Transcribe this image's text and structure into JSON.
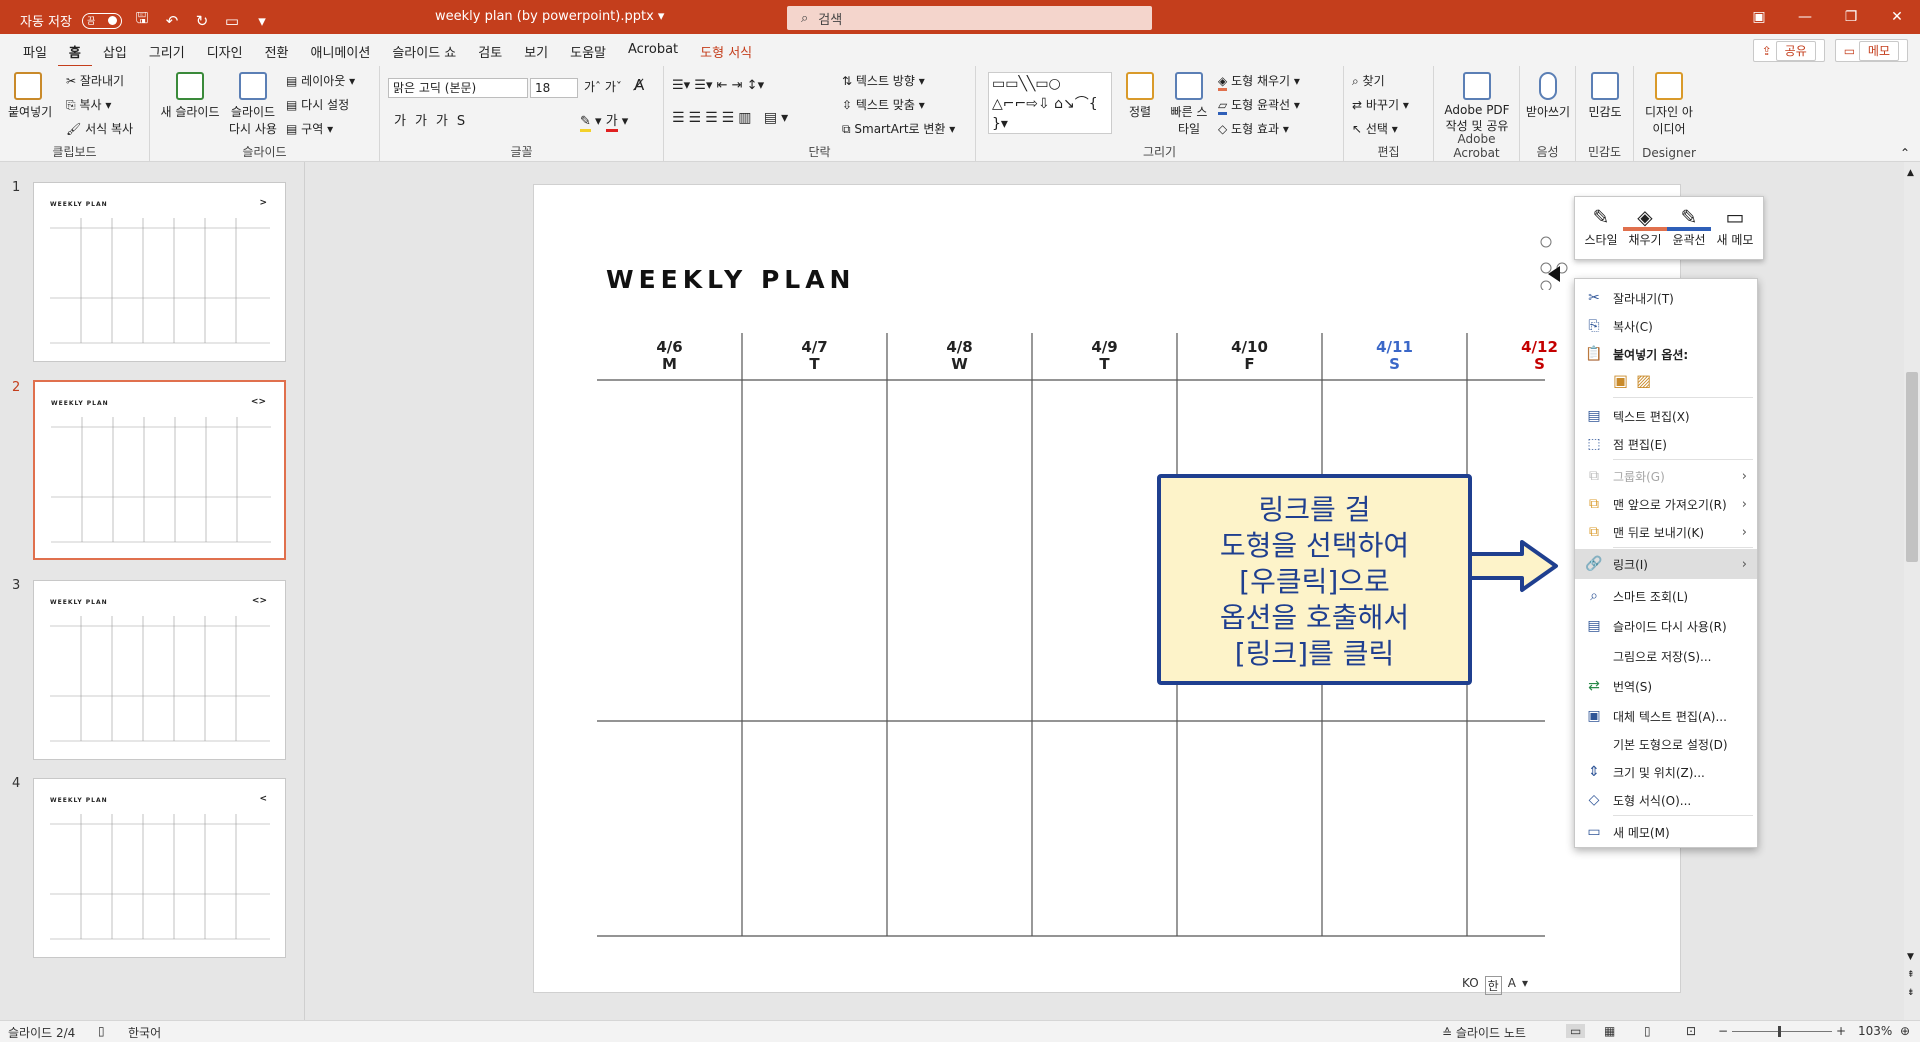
{
  "titlebar": {
    "autosave_label": "자동 저장",
    "autosave_state": "끔",
    "doc_title": "weekly plan (by powerpoint).pptx",
    "search_placeholder": "검색"
  },
  "menu": {
    "tabs": [
      "파일",
      "홈",
      "삽입",
      "그리기",
      "디자인",
      "전환",
      "애니메이션",
      "슬라이드 쇼",
      "검토",
      "보기",
      "도움말",
      "Acrobat",
      "도형 서식"
    ],
    "active_tab": "홈",
    "share_label": "공유",
    "comment_label": "메모"
  },
  "ribbon": {
    "clipboard": {
      "label": "클립보드",
      "paste": "붙여넣기",
      "cut": "잘라내기",
      "copy": "복사",
      "format_painter": "서식 복사"
    },
    "slides": {
      "label": "슬라이드",
      "new_slide": "새 슬라이드",
      "reuse": "슬라이드 다시 사용",
      "layout": "레이아웃",
      "reset": "다시 설정",
      "section": "구역"
    },
    "font": {
      "label": "글꼴",
      "font_name": "맑은 고딕 (본문)",
      "font_size": "18"
    },
    "paragraph": {
      "label": "단락",
      "text_direction": "텍스트 방향",
      "align_text": "텍스트 맞춤",
      "smartart": "SmartArt로 변환"
    },
    "drawing": {
      "label": "그리기",
      "arrange": "정렬",
      "quick_styles": "빠른 스타일",
      "fill": "도형 채우기",
      "outline": "도형 윤곽선",
      "effects": "도형 효과"
    },
    "editing": {
      "label": "편집",
      "find": "찾기",
      "replace": "바꾸기",
      "select": "선택"
    },
    "acrobat": {
      "label": "Adobe Acrobat",
      "create_pdf": "Adobe PDF 작성 및 공유"
    },
    "voice": {
      "label": "음성",
      "dictate": "받아쓰기"
    },
    "sensitivity": {
      "label": "민감도",
      "btn": "민감도"
    },
    "designer": {
      "label": "Designer",
      "btn": "디자인 아이디어"
    }
  },
  "slides_panel": {
    "thumbs": [
      {
        "num": "1",
        "title": "WEEKLY PLAN",
        "arrow": ">"
      },
      {
        "num": "2",
        "title": "WEEKLY PLAN",
        "arrow": "<>"
      },
      {
        "num": "3",
        "title": "WEEKLY PLAN",
        "arrow": "<>"
      },
      {
        "num": "4",
        "title": "WEEKLY PLAN",
        "arrow": "<"
      }
    ],
    "selected": 2
  },
  "slide": {
    "title": "WEEKLY PLAN",
    "days": [
      {
        "date": "4/6",
        "dow": "M",
        "color": "#111111"
      },
      {
        "date": "4/7",
        "dow": "T",
        "color": "#111111"
      },
      {
        "date": "4/8",
        "dow": "W",
        "color": "#111111"
      },
      {
        "date": "4/9",
        "dow": "T",
        "color": "#111111"
      },
      {
        "date": "4/10",
        "dow": "F",
        "color": "#111111"
      },
      {
        "date": "4/11",
        "dow": "S",
        "color": "#3a67c8"
      },
      {
        "date": "4/12",
        "dow": "S",
        "color": "#c40000"
      }
    ]
  },
  "callout": {
    "lines": [
      "링크를 걸",
      "도형을 선택하여",
      "[우클릭]으로",
      "옵션을 호출해서",
      "[링크]를 클릭"
    ]
  },
  "mini_toolbar": {
    "style": "스타일",
    "fill": "채우기",
    "outline": "윤곽선",
    "new_comment": "새 메모"
  },
  "context_menu": {
    "cut": "잘라내기(T)",
    "copy": "복사(C)",
    "paste_options": "붙여넣기 옵션:",
    "edit_text": "텍스트 편집(X)",
    "edit_points": "점 편집(E)",
    "group": "그룹화(G)",
    "bring_front": "맨 앞으로 가져오기(R)",
    "send_back": "맨 뒤로 보내기(K)",
    "link": "링크(I)",
    "smart_lookup": "스마트 조회(L)",
    "reuse_slides": "슬라이드 다시 사용(R)",
    "save_as_picture": "그림으로 저장(S)...",
    "translate": "번역(S)",
    "edit_alt_text": "대체 텍스트 편집(A)...",
    "set_default_shape": "기본 도형으로 설정(D)",
    "size_position": "크기 및 위치(Z)...",
    "format_shape": "도형 서식(O)...",
    "new_comment": "새 메모(M)"
  },
  "ime": {
    "lang": "KO",
    "mode": "한"
  },
  "statusbar": {
    "slide_pos": "슬라이드 2/4",
    "language": "한국어",
    "notes": "슬라이드 노트",
    "zoom": "103%"
  },
  "colors": {
    "accent": "#c43e1c",
    "callout_border": "#1f3f8f",
    "callout_fill": "#fdf3c9"
  }
}
